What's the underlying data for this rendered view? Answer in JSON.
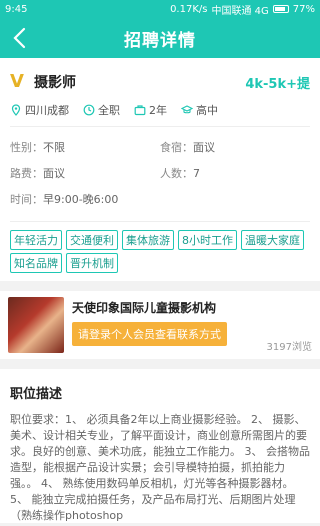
{
  "status": {
    "time": "9:45",
    "speed": "0.17K/s",
    "carrier": "中国联通 4G",
    "battery": "77%"
  },
  "nav": {
    "title": "招聘详情"
  },
  "job": {
    "title": "摄影师",
    "salary": "4k-5k+提",
    "badge": "V",
    "tags": [
      {
        "icon": "location-pin-icon",
        "label": "四川成都"
      },
      {
        "icon": "clock-icon",
        "label": "全职"
      },
      {
        "icon": "briefcase-icon",
        "label": "2年"
      },
      {
        "icon": "graduation-cap-icon",
        "label": "高中"
      }
    ],
    "info": {
      "gender": {
        "label": "性别：",
        "value": "不限"
      },
      "accommodation": {
        "label": "食宿：",
        "value": "面议"
      },
      "travel": {
        "label": "路费：",
        "value": "面议"
      },
      "headcount": {
        "label": "人数：",
        "value": "7"
      },
      "hours": {
        "label": "时间：",
        "value": "早9:00-晚6:00"
      }
    },
    "benefits": [
      "年轻活力",
      "交通便利",
      "集体旅游",
      "8小时工作",
      "温暖大家庭",
      "知名品牌",
      "晋升机制"
    ]
  },
  "company": {
    "name": "天使印象国际儿童摄影机构",
    "cta": "请登录个人会员查看联系方式",
    "views": "3197浏览"
  },
  "description": {
    "title": "职位描述",
    "body": "职位要求：1、 必须具备2年以上商业摄影经验。 2、 摄影、美术、设计相关专业，了解平面设计，商业创意所需图片的要求。良好的创意、美术功底，能独立工作能力。 3、 会搭物品造型，能根据产品设计实景；会引导模特拍摄，抓拍能力强。。 4、 熟练使用数码单反相机，灯光等各种摄影器材。 5、 能独立完成拍摄任务，及产品布局打光、后期图片处理（熟练操作photoshop"
  },
  "colors": {
    "accent": "#1ec7b4",
    "cta": "#f6b13a",
    "badge": "#e6b226"
  }
}
